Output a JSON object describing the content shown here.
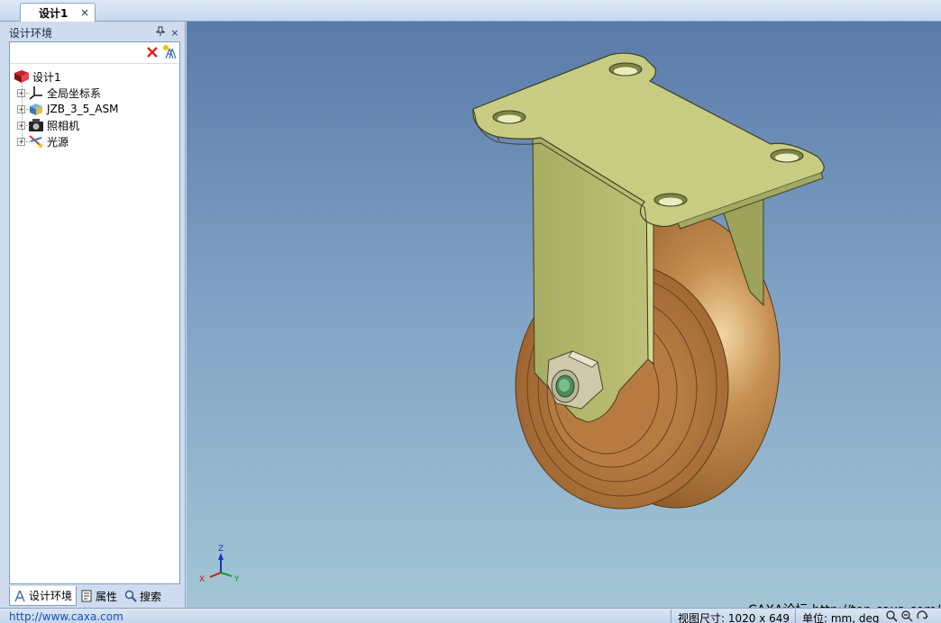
{
  "document_tab": {
    "label": "设计1",
    "close_glyph": "×"
  },
  "panel": {
    "title": "设计环境",
    "pin_glyph": "ᵖ",
    "close_glyph": "×",
    "toolbar": {
      "delete_icon": "red-x-icon",
      "tree_icon": "tree-structure-icon"
    },
    "tree": {
      "root": {
        "label": "设计1",
        "icon": "design-environment-icon"
      },
      "children": [
        {
          "label": "全局坐标系",
          "icon": "coordinate-system-icon",
          "expander": "+"
        },
        {
          "label": "JZB_3_5_ASM",
          "icon": "assembly-icon",
          "expander": "+"
        },
        {
          "label": "照相机",
          "icon": "camera-icon",
          "expander": "+"
        },
        {
          "label": "光源",
          "icon": "light-icon",
          "expander": "+"
        }
      ]
    },
    "tabs": [
      {
        "label": "设计环境",
        "icon": "tree-icon",
        "active": true
      },
      {
        "label": "属性",
        "icon": "properties-icon",
        "active": false
      },
      {
        "label": "搜索",
        "icon": "search-icon",
        "active": false
      }
    ]
  },
  "viewport": {
    "triad": {
      "z": "Z",
      "x": "X",
      "y": "Y"
    },
    "watermark": "CAXA论坛 http://top.caxa.com/",
    "colors": {
      "bracket": "#c7cc82",
      "wheel": "#b47a3c",
      "nut": "#c9c3a6"
    }
  },
  "statusbar": {
    "url": "http://www.caxa.com",
    "view_size": "视图尺寸: 1020 x 649",
    "unit": "单位: mm, deg"
  }
}
